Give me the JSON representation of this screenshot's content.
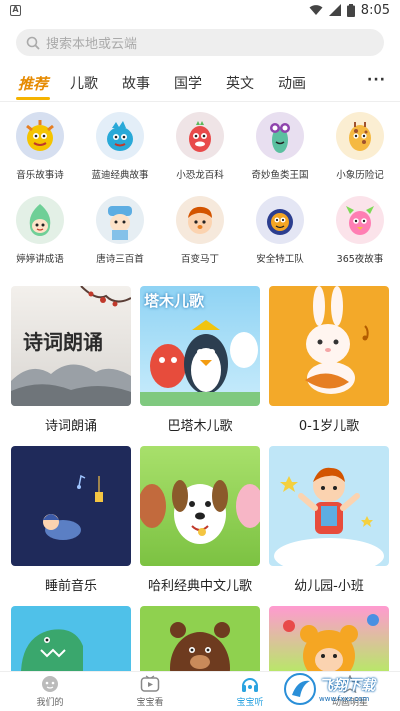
{
  "status": {
    "time": "8:05",
    "notif_icon": "A"
  },
  "search": {
    "placeholder": "搜索本地或云端"
  },
  "tabs": [
    {
      "label": "推荐",
      "active": true
    },
    {
      "label": "儿歌"
    },
    {
      "label": "故事"
    },
    {
      "label": "国学"
    },
    {
      "label": "英文"
    },
    {
      "label": "动画"
    }
  ],
  "more_label": "···",
  "icons": [
    {
      "label": "音乐故事诗",
      "bg": "#d6dff0"
    },
    {
      "label": "蓝迪经典故事",
      "bg": "#e3eef8"
    },
    {
      "label": "小恐龙百科",
      "bg": "#efe4e6"
    },
    {
      "label": "奇妙鱼类王国",
      "bg": "#e8dff0"
    },
    {
      "label": "小象历险记",
      "bg": "#fbeed2"
    },
    {
      "label": "婷婷讲成语",
      "bg": "#e3f0e6"
    },
    {
      "label": "唐诗三百首",
      "bg": "#e6eef3"
    },
    {
      "label": "百变马丁",
      "bg": "#f6e9dc"
    },
    {
      "label": "安全特工队",
      "bg": "#e4e6f4"
    },
    {
      "label": "365夜故事",
      "bg": "#fbe3ea"
    }
  ],
  "cards": [
    {
      "label": "诗词朗诵",
      "thumb_text": "诗词朗诵"
    },
    {
      "label": "巴塔木儿歌",
      "thumb_text": "塔木儿歌"
    },
    {
      "label": "0-1岁儿歌"
    },
    {
      "label": "睡前音乐"
    },
    {
      "label": "哈利经典中文儿歌"
    },
    {
      "label": "幼儿园-小班"
    }
  ],
  "nav": [
    {
      "label": "我们的",
      "active": false
    },
    {
      "label": "宝宝看",
      "active": false
    },
    {
      "label": "宝宝听",
      "active": true
    },
    {
      "label": "动画明星",
      "active": false
    }
  ],
  "watermark": {
    "text": "飞翔下载",
    "url": "www.fxxz.com"
  }
}
